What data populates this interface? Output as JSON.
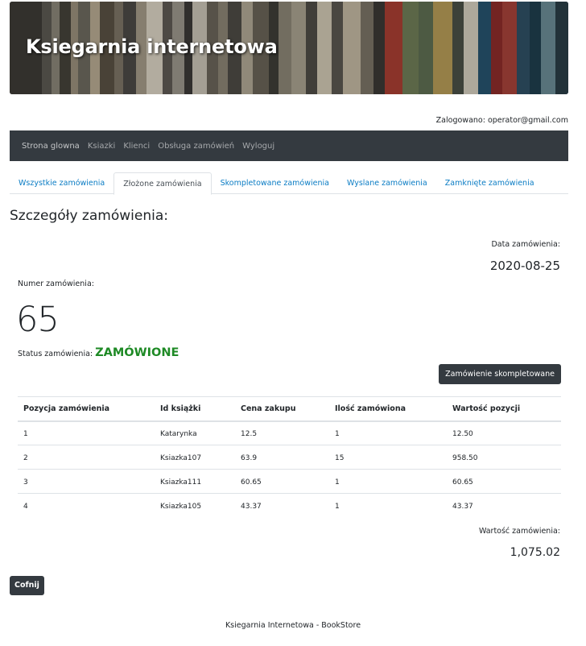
{
  "banner": {
    "title": "Ksiegarnia internetowa"
  },
  "user": {
    "logged_in_text": "Zalogowano: operator@gmail.com"
  },
  "navbar": {
    "items": [
      "Strona glowna",
      "Ksiazki",
      "Klienci",
      "Obsługa zamówień",
      "Wyloguj"
    ]
  },
  "tabs": {
    "items": [
      "Wszystkie zamówienia",
      "Złożone zamówienia",
      "Skompletowane zamówienia",
      "Wyslane zamówienia",
      "Zamknięte zamówienia"
    ],
    "active_index": 1
  },
  "order": {
    "page_title": "Szczegóły zamówienia:",
    "date_label": "Data zamówienia:",
    "date_value": "2020-08-25",
    "number_label": "Numer zamówienia:",
    "number_value": "65",
    "status_label": "Status zamówienia: ",
    "status_value": "ZAMÓWIONE",
    "status_color": "#1e8a25",
    "complete_button": "Zamówienie skompletowane",
    "total_label": "Wartość zamówienia:",
    "total_value": "1,075.02",
    "back_button": "Cofnij"
  },
  "table": {
    "headers": [
      "Pozycja zamówienia",
      "Id książki",
      "Cena zakupu",
      "Ilość zamówiona",
      "Wartość pozycji"
    ],
    "rows": [
      [
        "1",
        "Katarynka",
        "12.5",
        "1",
        "12.50"
      ],
      [
        "2",
        "Ksiazka107",
        "63.9",
        "15",
        "958.50"
      ],
      [
        "3",
        "Ksiazka111",
        "60.65",
        "1",
        "60.65"
      ],
      [
        "4",
        "Ksiazka105",
        "43.37",
        "1",
        "43.37"
      ]
    ]
  },
  "footer": {
    "text": "Ksiegarnia Internetowa - BookStore"
  },
  "colors": {
    "navbar": "#343a40",
    "link": "#0a7cc4",
    "status": "#1e8a25"
  }
}
